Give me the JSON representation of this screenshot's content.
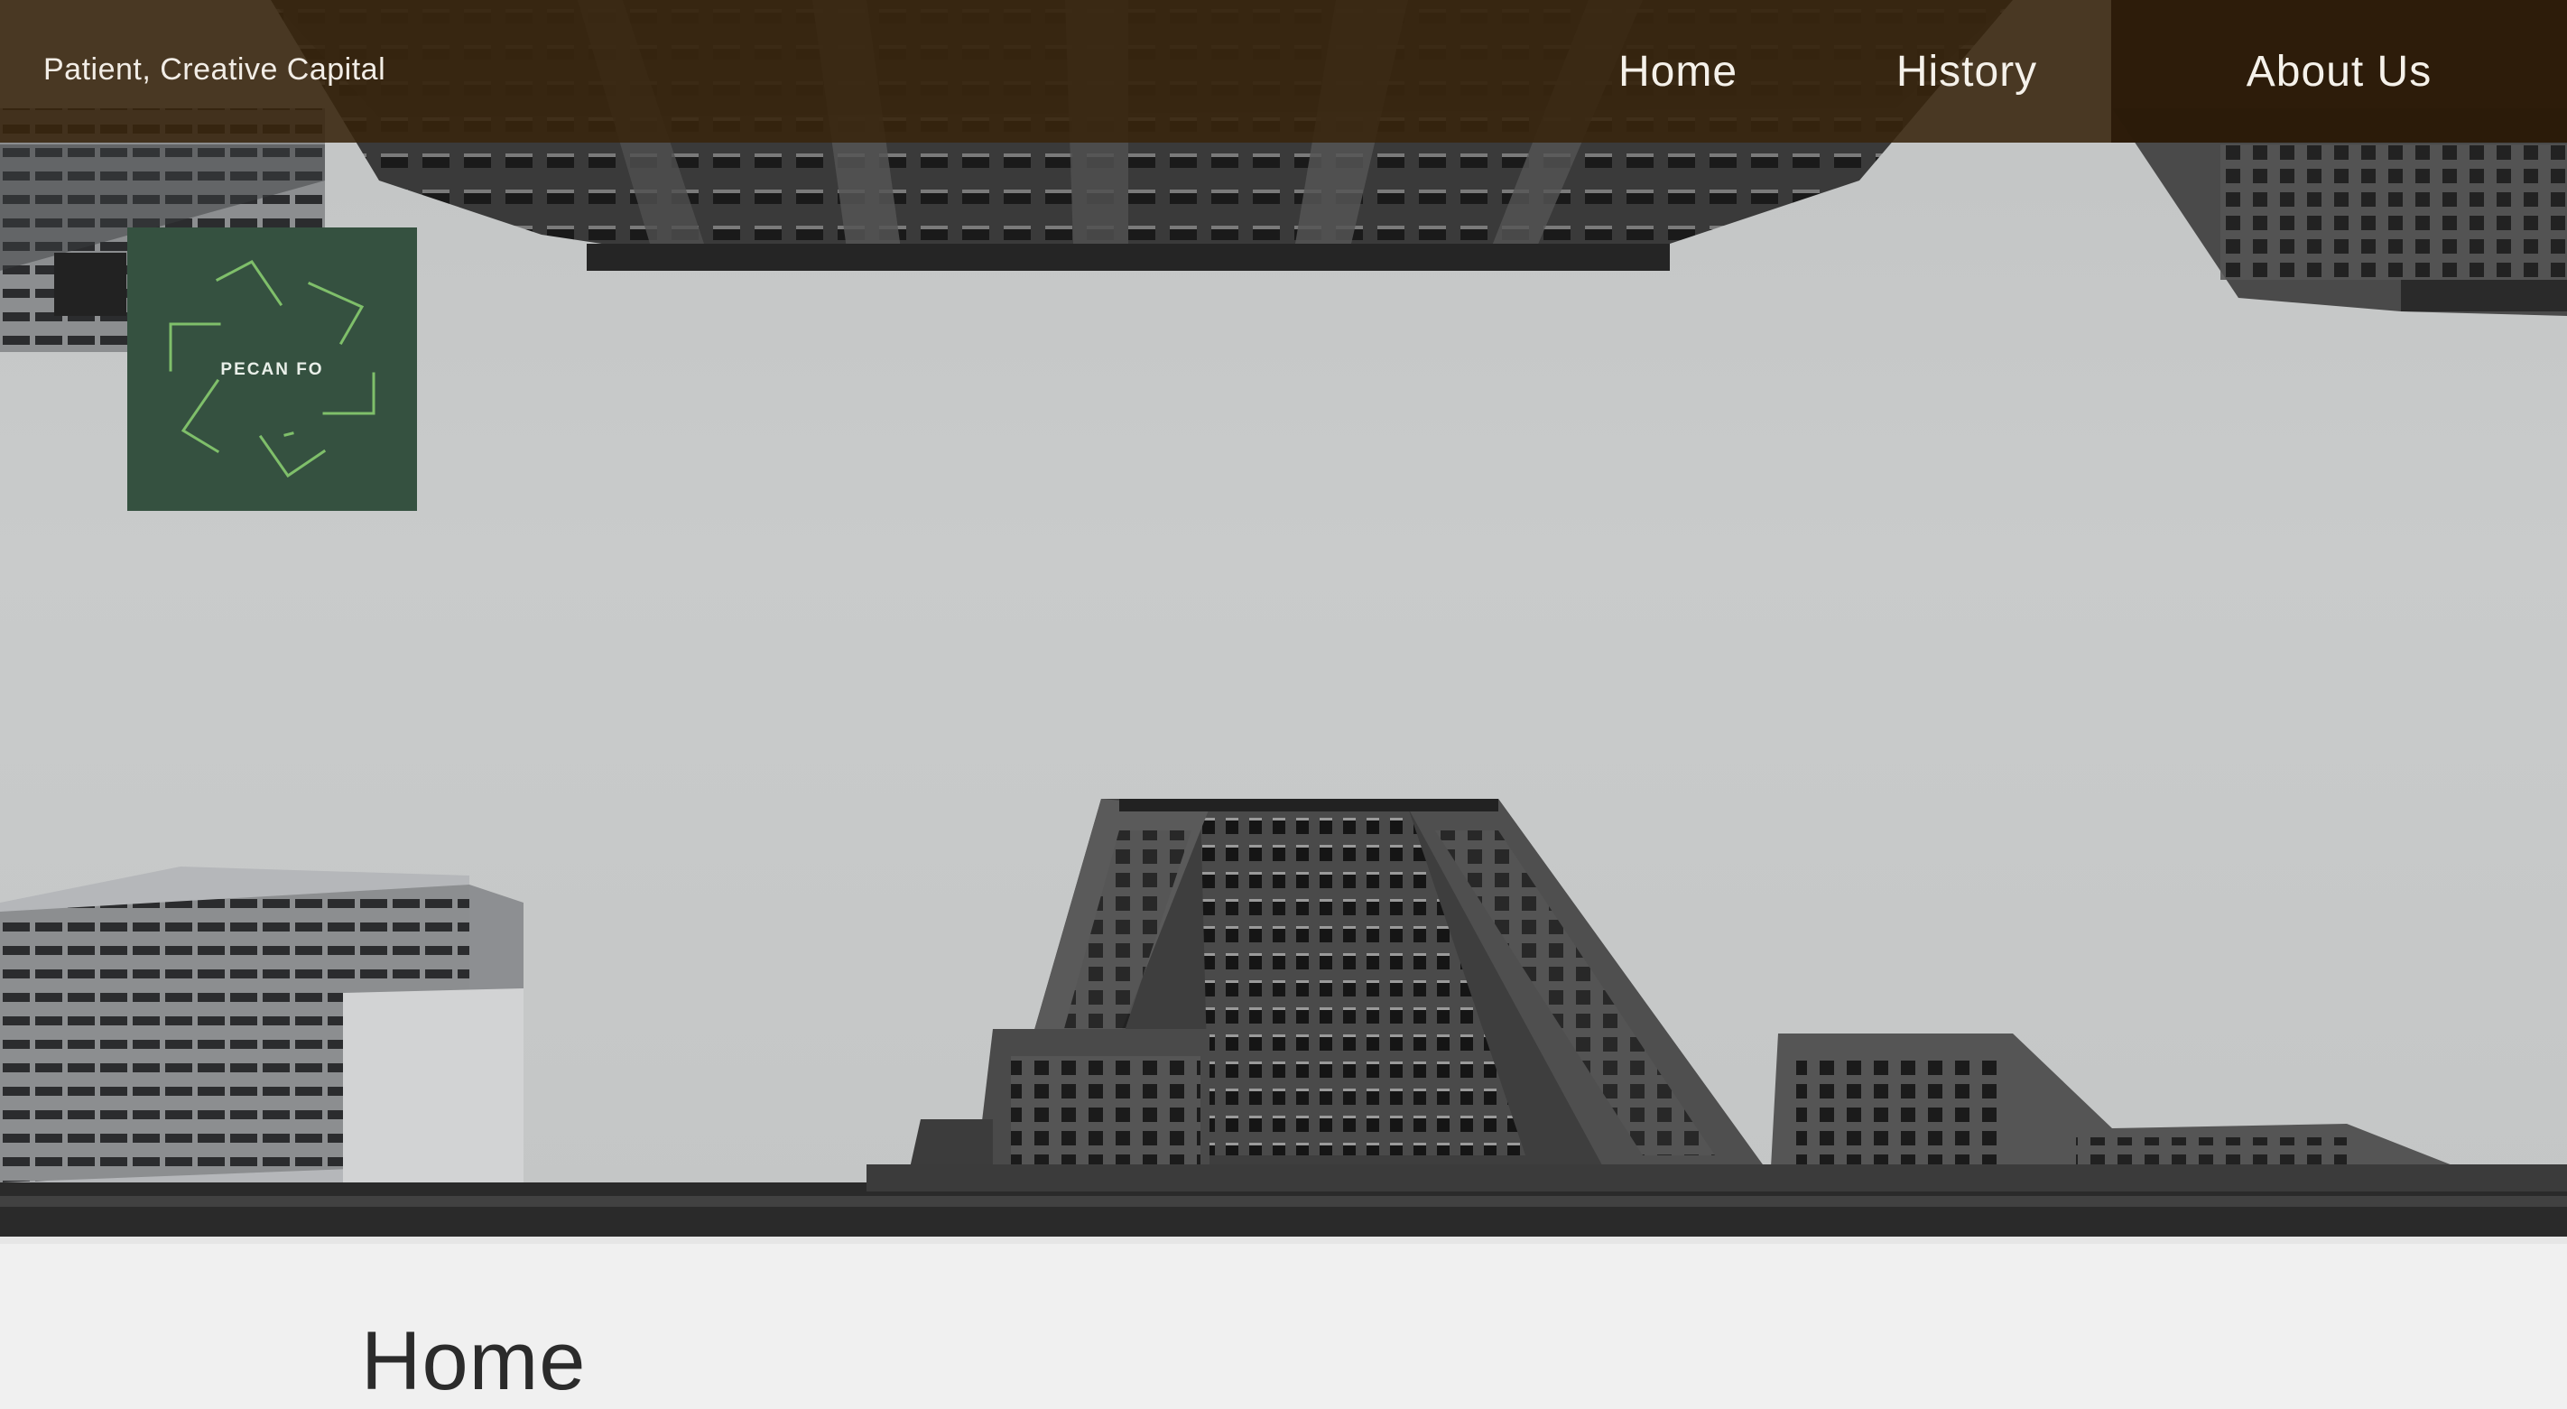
{
  "header": {
    "tagline": "Patient, Creative Capital",
    "nav": [
      {
        "label": "Home"
      },
      {
        "label": "History"
      },
      {
        "label": "About Us"
      }
    ]
  },
  "logo": {
    "text": "PECAN FO",
    "background_color": "#355140",
    "stroke_color": "#7fbf6a"
  },
  "hero": {
    "description_icon": "skyscraper-photo"
  },
  "main": {
    "title": "Home"
  },
  "colors": {
    "header_bg": "#38240c",
    "about_bg": "#2a1a08",
    "page_bg": "#f0f0f0"
  }
}
